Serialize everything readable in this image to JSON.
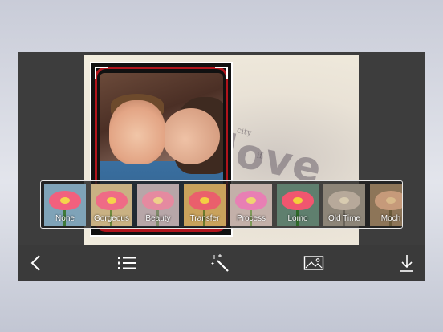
{
  "filters": [
    {
      "label": "None",
      "selected": true,
      "bg": "#7fa3b8",
      "petal": "#f2607e",
      "center": "#f4d44c",
      "stem": "#3f7a3a"
    },
    {
      "label": "Gorgeous",
      "selected": false,
      "bg": "#c9b183",
      "petal": "#ef6b86",
      "center": "#f6d34a",
      "stem": "#6f8a3c"
    },
    {
      "label": "Beauty",
      "selected": false,
      "bg": "#b7a6a8",
      "petal": "#e58aa0",
      "center": "#efd08a",
      "stem": "#7f8a6a"
    },
    {
      "label": "Transfer",
      "selected": false,
      "bg": "#c9a25c",
      "petal": "#ea5f6c",
      "center": "#f3cf43",
      "stem": "#6b7a2c"
    },
    {
      "label": "Process",
      "selected": false,
      "bg": "#c3b0a9",
      "petal": "#e87fb4",
      "center": "#f0d472",
      "stem": "#7f9a5a"
    },
    {
      "label": "Lomo",
      "selected": false,
      "bg": "#5f7f6e",
      "petal": "#f1566f",
      "center": "#f4cf3a",
      "stem": "#2f6a2a"
    },
    {
      "label": "Old Time",
      "selected": false,
      "bg": "#8d8578",
      "petal": "#b7a99a",
      "center": "#d8cbb0",
      "stem": "#6a645a"
    },
    {
      "label": "Moch",
      "selected": false,
      "bg": "#8d7558",
      "petal": "#c69a7a",
      "center": "#d8b98a",
      "stem": "#6a5a3a"
    }
  ],
  "toolbar": [
    {
      "name": "back-button",
      "icon": "chevron-left-icon"
    },
    {
      "name": "menu-button",
      "icon": "list-icon"
    },
    {
      "name": "magic-wand-button",
      "icon": "magic-wand-icon"
    },
    {
      "name": "background-image-button",
      "icon": "image-icon"
    },
    {
      "name": "download-button",
      "icon": "download-icon"
    }
  ],
  "colors": {
    "accent": "#2a6fe0",
    "toolbar_bg": "#3a3a3a",
    "frame_red": "#b0141c"
  }
}
